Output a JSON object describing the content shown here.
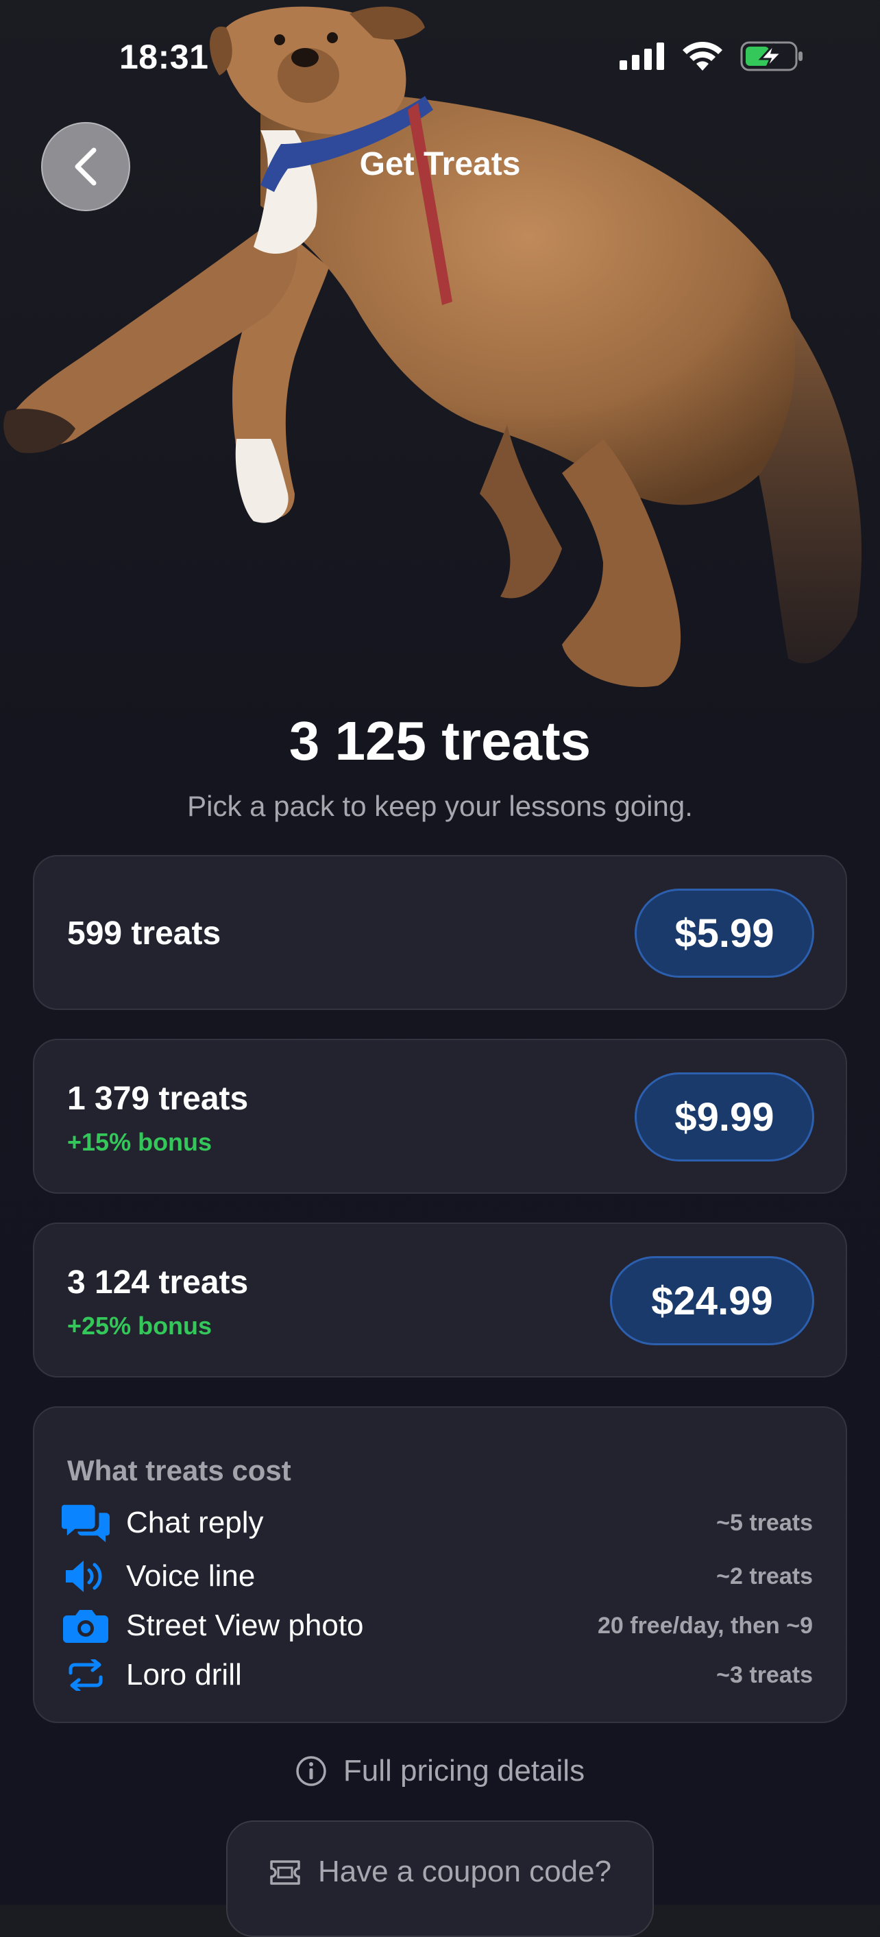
{
  "status_bar": {
    "time": "18:31"
  },
  "header": {
    "title": "Get Treats"
  },
  "balance": {
    "amount": "3 125 treats",
    "subtitle": "Pick a pack to keep your lessons going."
  },
  "packs": [
    {
      "name": "599 treats",
      "bonus": "",
      "price": "$5.99"
    },
    {
      "name": "1 379 treats",
      "bonus": "+15% bonus",
      "price": "$9.99"
    },
    {
      "name": "3 124 treats",
      "bonus": "+25% bonus",
      "price": "$24.99"
    }
  ],
  "costs": {
    "title": "What treats cost",
    "items": [
      {
        "label": "Chat reply",
        "value": "~5 treats",
        "icon": "chat-bubbles-icon"
      },
      {
        "label": "Voice line",
        "value": "~2 treats",
        "icon": "speaker-icon"
      },
      {
        "label": "Street View photo",
        "value": "20 free/day, then ~9",
        "icon": "camera-icon"
      },
      {
        "label": "Loro drill",
        "value": "~3 treats",
        "icon": "repeat-icon"
      }
    ]
  },
  "footer": {
    "pricing_link": "Full pricing details",
    "coupon": "Have a coupon code?"
  },
  "colors": {
    "accent": "#0a84ff",
    "bonus": "#34c759",
    "price_button": "#1a3a6b"
  }
}
